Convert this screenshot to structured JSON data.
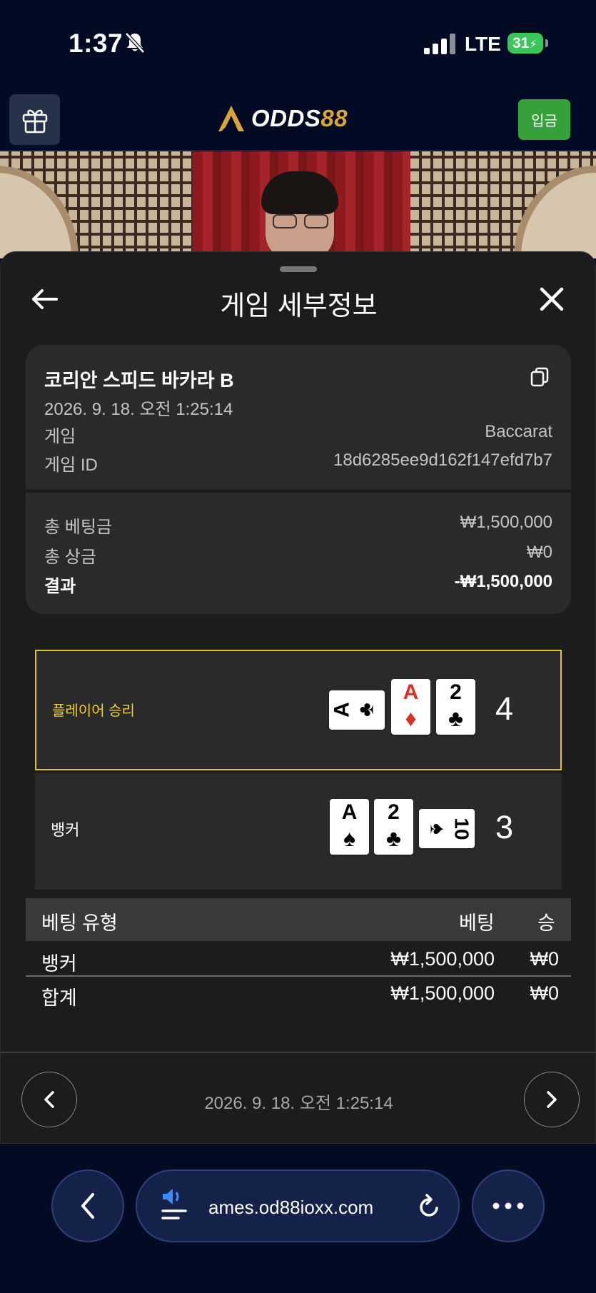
{
  "status_bar": {
    "time": "1:37",
    "network": "LTE",
    "battery": "31"
  },
  "header": {
    "logo_main": "ODDS",
    "logo_accent": "88",
    "deposit_label": "입금"
  },
  "sheet": {
    "title": "게임 세부정보",
    "game": {
      "name": "코리안 스피드 바카라 B",
      "datetime": "2026. 9. 18. 오전 1:25:14",
      "type_label": "게임",
      "type_value": "Baccarat",
      "id_label": "게임 ID",
      "id_value": "18d6285ee9d162f147efd7b7"
    },
    "summary": {
      "total_bet_label": "총 베팅금",
      "total_bet_value": "₩1,500,000",
      "total_win_label": "총 상금",
      "total_win_value": "₩0",
      "result_label": "결과",
      "result_value": "-₩1,500,000"
    },
    "hands": {
      "player": {
        "label": "플레이어 승리",
        "score": "4",
        "cards": [
          {
            "rank": "A",
            "suit": "♣",
            "color": "#000000",
            "orientation": "horizontal"
          },
          {
            "rank": "A",
            "suit": "♦",
            "color": "#d9312a",
            "orientation": "vertical"
          },
          {
            "rank": "2",
            "suit": "♣",
            "color": "#000000",
            "orientation": "vertical"
          }
        ]
      },
      "banker": {
        "label": "뱅커",
        "score": "3",
        "cards": [
          {
            "rank": "A",
            "suit": "♠",
            "color": "#000000",
            "orientation": "vertical"
          },
          {
            "rank": "2",
            "suit": "♣",
            "color": "#000000",
            "orientation": "vertical"
          },
          {
            "rank": "10",
            "suit": "♠",
            "color": "#000000",
            "orientation": "horizontal"
          }
        ]
      }
    },
    "bet_table": {
      "columns": [
        "베팅 유형",
        "베팅",
        "승"
      ],
      "rows": [
        {
          "type": "뱅커",
          "bet": "₩1,500,000",
          "win": "₩0"
        }
      ],
      "total": {
        "type": "합계",
        "bet": "₩1,500,000",
        "win": "₩0"
      }
    },
    "footer_datetime": "2026. 9. 18. 오전 1:25:14"
  },
  "browser": {
    "url": "ames.od88ioxx.com"
  },
  "colors": {
    "accent_gold": "#e3c235",
    "deposit_green": "#36a03a",
    "battery_green": "#3bc45a",
    "red_suit": "#d9312a"
  }
}
